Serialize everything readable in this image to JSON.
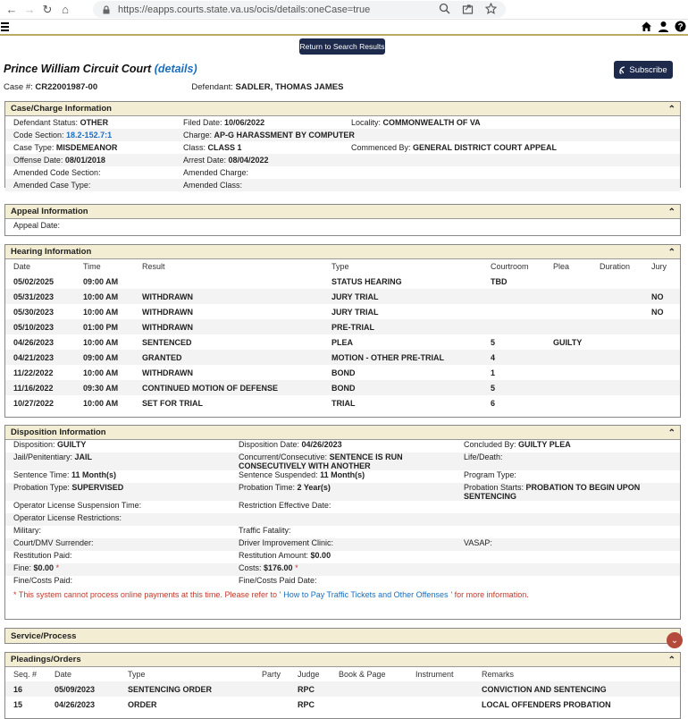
{
  "browser": {
    "url": "https://eapps.courts.state.va.us/ocis/details:oneCase=true"
  },
  "app": {
    "back_button": "Return to Search Results",
    "court": "Prince William Circuit Court",
    "details_link": "(details)",
    "subscribe": "Subscribe",
    "case_label": "Case #:",
    "case_number": "CR22001987-00",
    "defendant_label": "Defendant:",
    "defendant": "SADLER, THOMAS JAMES"
  },
  "case_charge": {
    "title": "Case/Charge Information",
    "rows": [
      [
        {
          "l": "Defendant Status:",
          "v": "OTHER"
        },
        {
          "l": "Filed Date:",
          "v": "10/06/2022"
        },
        {
          "l": "Locality:",
          "v": "COMMONWEALTH OF VA"
        }
      ],
      [
        {
          "l": "Code Section:",
          "v": "18.2-152.7:1"
        },
        {
          "l": "Charge:",
          "v": "AP-G HARASSMENT BY COMPUTER"
        },
        {
          "l": "",
          "v": ""
        }
      ],
      [
        {
          "l": "Case Type:",
          "v": "MISDEMEANOR"
        },
        {
          "l": "Class:",
          "v": "CLASS 1"
        },
        {
          "l": "Commenced By:",
          "v": "GENERAL DISTRICT COURT APPEAL"
        }
      ],
      [
        {
          "l": "Offense Date:",
          "v": "08/01/2018"
        },
        {
          "l": "Arrest Date:",
          "v": "08/04/2022"
        },
        {
          "l": "",
          "v": ""
        }
      ],
      [
        {
          "l": "Amended Code Section:",
          "v": ""
        },
        {
          "l": "Amended Charge:",
          "v": ""
        },
        {
          "l": "",
          "v": ""
        }
      ],
      [
        {
          "l": "Amended Case Type:",
          "v": ""
        },
        {
          "l": "Amended Class:",
          "v": ""
        },
        {
          "l": "",
          "v": ""
        }
      ]
    ]
  },
  "appeal": {
    "title": "Appeal Information",
    "appeal_date_label": "Appeal Date:"
  },
  "hearing": {
    "title": "Hearing Information",
    "headers": [
      "Date",
      "Time",
      "Result",
      "Type",
      "Courtroom",
      "Plea",
      "Duration",
      "Jury"
    ],
    "rows": [
      [
        "05/02/2025",
        "09:00 AM",
        "",
        "STATUS HEARING",
        "TBD",
        "",
        "",
        ""
      ],
      [
        "05/31/2023",
        "10:00 AM",
        "WITHDRAWN",
        "JURY TRIAL",
        "",
        "",
        "",
        "NO"
      ],
      [
        "05/30/2023",
        "10:00 AM",
        "WITHDRAWN",
        "JURY TRIAL",
        "",
        "",
        "",
        "NO"
      ],
      [
        "05/10/2023",
        "01:00 PM",
        "WITHDRAWN",
        "PRE-TRIAL",
        "",
        "",
        "",
        ""
      ],
      [
        "04/26/2023",
        "10:00 AM",
        "SENTENCED",
        "PLEA",
        "5",
        "GUILTY",
        "",
        ""
      ],
      [
        "04/21/2023",
        "09:00 AM",
        "GRANTED",
        "MOTION - OTHER PRE-TRIAL",
        "4",
        "",
        "",
        ""
      ],
      [
        "11/22/2022",
        "10:00 AM",
        "WITHDRAWN",
        "BOND",
        "1",
        "",
        "",
        ""
      ],
      [
        "11/16/2022",
        "09:30 AM",
        "CONTINUED MOTION OF DEFENSE",
        "BOND",
        "5",
        "",
        "",
        ""
      ],
      [
        "10/27/2022",
        "10:00 AM",
        "SET FOR TRIAL",
        "TRIAL",
        "6",
        "",
        "",
        ""
      ]
    ]
  },
  "disposition": {
    "title": "Disposition Information",
    "rows": [
      [
        {
          "l": "Disposition:",
          "v": "GUILTY"
        },
        {
          "l": "Disposition Date:",
          "v": "04/26/2023"
        },
        {
          "l": "Concluded By:",
          "v": "GUILTY PLEA"
        }
      ],
      [
        {
          "l": "Jail/Penitentiary:",
          "v": "JAIL"
        },
        {
          "l": "Concurrent/Consecutive:",
          "v": "SENTENCE IS RUN CONSECUTIVELY WITH ANOTHER"
        },
        {
          "l": "Life/Death:",
          "v": ""
        }
      ],
      [
        {
          "l": "Sentence Time:",
          "v": "11 Month(s)"
        },
        {
          "l": "Sentence Suspended:",
          "v": "11 Month(s)"
        },
        {
          "l": "Program Type:",
          "v": ""
        }
      ],
      [
        {
          "l": "Probation Type:",
          "v": "SUPERVISED"
        },
        {
          "l": "Probation Time:",
          "v": "2 Year(s)"
        },
        {
          "l": "Probation Starts:",
          "v": "PROBATION TO BEGIN UPON SENTENCING"
        }
      ],
      [
        {
          "l": "Operator License Suspension Time:",
          "v": ""
        },
        {
          "l": "Restriction Effective Date:",
          "v": ""
        },
        {
          "l": "",
          "v": ""
        }
      ],
      [
        {
          "l": "Operator License Restrictions:",
          "v": ""
        },
        {
          "l": "",
          "v": ""
        },
        {
          "l": "",
          "v": ""
        }
      ],
      [
        {
          "l": "Military:",
          "v": ""
        },
        {
          "l": "Traffic Fatality:",
          "v": ""
        },
        {
          "l": "",
          "v": ""
        }
      ],
      [
        {
          "l": "Court/DMV Surrender:",
          "v": ""
        },
        {
          "l": "Driver Improvement Clinic:",
          "v": ""
        },
        {
          "l": "VASAP:",
          "v": ""
        }
      ],
      [
        {
          "l": "Restitution Paid:",
          "v": ""
        },
        {
          "l": "Restitution Amount:",
          "v": "$0.00"
        },
        {
          "l": "",
          "v": ""
        }
      ],
      [
        {
          "l": "Fine:",
          "v": "$0.00",
          "star": true
        },
        {
          "l": "Costs:",
          "v": "$176.00",
          "star": true
        },
        {
          "l": "",
          "v": ""
        }
      ],
      [
        {
          "l": "Fine/Costs Paid:",
          "v": ""
        },
        {
          "l": "Fine/Costs Paid Date:",
          "v": ""
        },
        {
          "l": "",
          "v": ""
        }
      ]
    ],
    "note_pre": "* This system cannot process online payments at this time. Please refer to '",
    "note_link": "How to Pay Traffic Tickets and Other Offenses",
    "note_post": "' for more information."
  },
  "service": {
    "title": "Service/Process"
  },
  "pleadings": {
    "title": "Pleadings/Orders",
    "headers": [
      "Seq. #",
      "Date",
      "Type",
      "Party",
      "Judge",
      "Book & Page",
      "Instrument",
      "Remarks"
    ],
    "rows": [
      [
        "16",
        "05/09/2023",
        "SENTENCING ORDER",
        "",
        "RPC",
        "",
        "",
        "CONVICTION AND SENTENCING"
      ],
      [
        "15",
        "04/26/2023",
        "ORDER",
        "",
        "RPC",
        "",
        "",
        "LOCAL OFFENDERS PROBATION"
      ]
    ]
  },
  "colors": {
    "navy": "#1d2a4b",
    "header_bg": "#f3eed3",
    "link": "#1a6ebd",
    "alert": "#c0392b"
  }
}
